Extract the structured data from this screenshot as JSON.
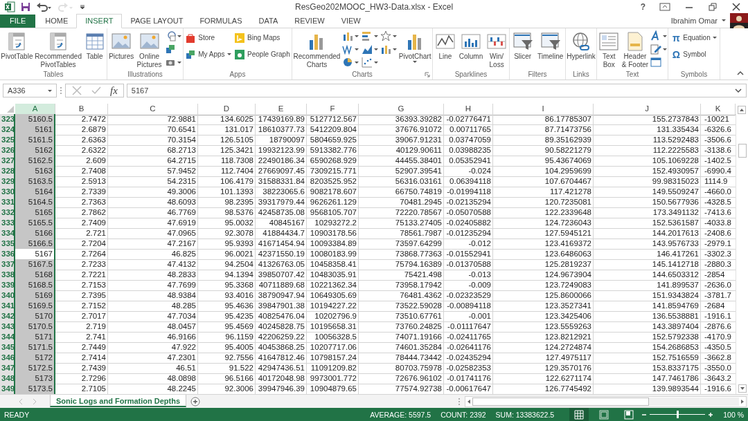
{
  "window": {
    "title": "ResGeo202MOOC_HW3-Data.xlsx - Excel",
    "help": "?"
  },
  "quick_access": [
    {
      "kind": "save",
      "disabled": false
    },
    {
      "kind": "undo",
      "disabled": false
    },
    {
      "kind": "redo",
      "disabled": true
    },
    {
      "kind": "customize",
      "disabled": false
    }
  ],
  "user": {
    "name": "Ibrahim Omar"
  },
  "tabs": [
    {
      "label": "FILE",
      "kind": "file",
      "selected": false
    },
    {
      "label": "HOME",
      "kind": "tab",
      "selected": false
    },
    {
      "label": "INSERT",
      "kind": "tab",
      "selected": true
    },
    {
      "label": "PAGE LAYOUT",
      "kind": "tab",
      "selected": false
    },
    {
      "label": "FORMULAS",
      "kind": "tab",
      "selected": false
    },
    {
      "label": "DATA",
      "kind": "tab",
      "selected": false
    },
    {
      "label": "REVIEW",
      "kind": "tab",
      "selected": false
    },
    {
      "label": "VIEW",
      "kind": "tab",
      "selected": false
    }
  ],
  "ribbon": {
    "groups": [
      {
        "label": "Tables",
        "items": [
          {
            "kind": "large",
            "label": "PivotTable",
            "dropdown": false
          },
          {
            "kind": "large",
            "label": "Recommended\nPivotTables",
            "dropdown": false
          },
          {
            "kind": "large",
            "label": "Table",
            "dropdown": false
          }
        ]
      },
      {
        "label": "Illustrations",
        "items": [
          {
            "kind": "large",
            "label": "Pictures",
            "dropdown": false
          },
          {
            "kind": "large",
            "label": "Online\nPictures",
            "dropdown": false
          },
          {
            "kind": "stack",
            "items": [
              {
                "kind": "mini",
                "dropdown": true
              },
              {
                "kind": "mini",
                "dropdown": false
              },
              {
                "kind": "mini",
                "dropdown": true
              }
            ]
          }
        ]
      },
      {
        "label": "Apps",
        "items": [
          {
            "kind": "stack",
            "items": [
              {
                "kind": "small",
                "label": "Store",
                "dropdown": false
              },
              {
                "kind": "small",
                "label": "My Apps",
                "dropdown": true
              }
            ]
          },
          {
            "kind": "stack",
            "items": [
              {
                "kind": "small",
                "label": "Bing Maps",
                "dropdown": false
              },
              {
                "kind": "small",
                "label": "People Graph",
                "dropdown": false
              }
            ]
          }
        ]
      },
      {
        "label": "Charts",
        "launcher": true,
        "items": [
          {
            "kind": "large",
            "label": "Recommended\nCharts",
            "dropdown": false
          },
          {
            "kind": "stack",
            "items": [
              {
                "kind": "mini",
                "dropdown": true
              },
              {
                "kind": "mini",
                "dropdown": true
              },
              {
                "kind": "mini",
                "dropdown": true
              }
            ]
          },
          {
            "kind": "stack",
            "items": [
              {
                "kind": "mini",
                "dropdown": true
              },
              {
                "kind": "mini",
                "dropdown": true
              },
              {
                "kind": "mini",
                "dropdown": true
              }
            ]
          },
          {
            "kind": "stack",
            "items": [
              {
                "kind": "mini",
                "dropdown": true
              },
              {
                "kind": "mini",
                "dropdown": true
              }
            ]
          },
          {
            "kind": "large",
            "label": "PivotChart",
            "dropdown": true
          }
        ]
      },
      {
        "label": "Sparklines",
        "items": [
          {
            "kind": "large",
            "label": "Line",
            "dropdown": false
          },
          {
            "kind": "large",
            "label": "Column",
            "dropdown": false
          },
          {
            "kind": "large",
            "label": "Win/\nLoss",
            "dropdown": false
          }
        ]
      },
      {
        "label": "Filters",
        "items": [
          {
            "kind": "large",
            "label": "Slicer",
            "dropdown": false
          },
          {
            "kind": "large",
            "label": "Timeline",
            "dropdown": false
          }
        ]
      },
      {
        "label": "Links",
        "items": [
          {
            "kind": "large",
            "label": "Hyperlink",
            "dropdown": false
          }
        ]
      },
      {
        "label": "Text",
        "items": [
          {
            "kind": "large",
            "label": "Text\nBox",
            "dropdown": false
          },
          {
            "kind": "large",
            "label": "Header\n& Footer",
            "dropdown": false
          },
          {
            "kind": "stack",
            "items": [
              {
                "kind": "mini",
                "dropdown": true
              },
              {
                "kind": "mini",
                "dropdown": true
              },
              {
                "kind": "mini",
                "dropdown": false
              }
            ]
          }
        ]
      },
      {
        "label": "Symbols",
        "items": [
          {
            "kind": "stack",
            "items": [
              {
                "kind": "glyph",
                "glyph": "π",
                "label": "Equation",
                "dropdown": true
              },
              {
                "kind": "glyph",
                "glyph": "Ω",
                "label": "Symbol",
                "dropdown": false
              }
            ]
          }
        ]
      }
    ]
  },
  "formula_bar": {
    "name_box": "A336",
    "fx": "fx",
    "value": "5167"
  },
  "table": {
    "columns": [
      {
        "label": "A",
        "selected": true
      },
      {
        "label": "B",
        "selected": false
      },
      {
        "label": "C",
        "selected": false
      },
      {
        "label": "D",
        "selected": false
      },
      {
        "label": "E",
        "selected": false
      },
      {
        "label": "F",
        "selected": false
      },
      {
        "label": "G",
        "selected": false
      },
      {
        "label": "H",
        "selected": false
      },
      {
        "label": "I",
        "selected": false
      },
      {
        "label": "J",
        "selected": false
      },
      {
        "label": "K",
        "selected": false
      }
    ],
    "rows": [
      {
        "header": "323",
        "selected": true,
        "active": false,
        "cells": [
          "5160.5",
          "2.7472",
          "72.9881",
          "134.6025",
          "17439169.89",
          "5127712.567",
          "36393.39282",
          "-0.02776471",
          "86.17785307",
          "155.2737843",
          "-10021"
        ]
      },
      {
        "header": "324",
        "selected": true,
        "active": false,
        "cells": [
          "5161",
          "2.6879",
          "70.6541",
          "131.017",
          "18610377.73",
          "5412209.804",
          "37676.91072",
          "0.00711765",
          "87.71473756",
          "131.335434",
          "-6326.6"
        ]
      },
      {
        "header": "325",
        "selected": true,
        "active": false,
        "cells": [
          "5161.5",
          "2.6363",
          "70.3154",
          "126.5105",
          "18790097",
          "5804659.925",
          "39067.91231",
          "0.03747059",
          "89.35162939",
          "113.5292483",
          "-3506.6"
        ]
      },
      {
        "header": "326",
        "selected": true,
        "active": false,
        "cells": [
          "5162",
          "2.6322",
          "68.2713",
          "125.3421",
          "19932123.99",
          "5913382.776",
          "40129.90611",
          "0.03988235",
          "90.58221279",
          "112.2225583",
          "-3138.6"
        ]
      },
      {
        "header": "327",
        "selected": true,
        "active": false,
        "cells": [
          "5162.5",
          "2.609",
          "64.2715",
          "118.7308",
          "22490186.34",
          "6590268.929",
          "44455.38401",
          "0.05352941",
          "95.43674069",
          "105.1069228",
          "-1402.5"
        ]
      },
      {
        "header": "328",
        "selected": true,
        "active": false,
        "cells": [
          "5163",
          "2.7408",
          "57.9452",
          "112.7404",
          "27669097.45",
          "7309215.771",
          "52907.39541",
          "-0.024",
          "104.2959699",
          "152.4930957",
          "-6990.4"
        ]
      },
      {
        "header": "329",
        "selected": true,
        "active": false,
        "cells": [
          "5163.5",
          "2.5913",
          "54.2315",
          "106.4179",
          "31588331.84",
          "8203525.952",
          "56316.03161",
          "0.06394118",
          "107.6704467",
          "99.98315023",
          "1114.9"
        ]
      },
      {
        "header": "330",
        "selected": true,
        "active": false,
        "cells": [
          "5164",
          "2.7339",
          "49.3006",
          "101.1393",
          "38223065.6",
          "9082178.607",
          "66750.74819",
          "-0.01994118",
          "117.421278",
          "149.5509247",
          "-4660.0"
        ]
      },
      {
        "header": "331",
        "selected": true,
        "active": false,
        "cells": [
          "5164.5",
          "2.7363",
          "48.6093",
          "98.2395",
          "39317979.44",
          "9626261.129",
          "70481.2945",
          "-0.02135294",
          "120.7235081",
          "150.5677936",
          "-4328.5"
        ]
      },
      {
        "header": "332",
        "selected": true,
        "active": false,
        "cells": [
          "5165",
          "2.7862",
          "46.7769",
          "98.5376",
          "42458735.08",
          "9568105.707",
          "72220.78567",
          "-0.05070588",
          "122.2339648",
          "173.3491132",
          "-7413.6"
        ]
      },
      {
        "header": "333",
        "selected": true,
        "active": false,
        "cells": [
          "5165.5",
          "2.7409",
          "47.6919",
          "95.0032",
          "40845167",
          "10293272.2",
          "75133.27405",
          "-0.02405882",
          "124.7236043",
          "152.5361587",
          "-4033.8"
        ]
      },
      {
        "header": "334",
        "selected": true,
        "active": false,
        "cells": [
          "5166",
          "2.721",
          "47.0965",
          "92.3078",
          "41884434.7",
          "10903178.56",
          "78561.7987",
          "-0.01235294",
          "127.5945121",
          "144.2017613",
          "-2408.6"
        ]
      },
      {
        "header": "335",
        "selected": true,
        "active": false,
        "cells": [
          "5166.5",
          "2.7204",
          "47.2167",
          "95.9393",
          "41671454.94",
          "10093384.89",
          "73597.64299",
          "-0.012",
          "123.4169372",
          "143.9576733",
          "-2979.1"
        ]
      },
      {
        "header": "336",
        "selected": true,
        "active": true,
        "cells": [
          "5167",
          "2.7264",
          "46.825",
          "96.0021",
          "42371550.19",
          "10080183.99",
          "73868.77363",
          "-0.01552941",
          "123.6486063",
          "146.417261",
          "-3302.3"
        ]
      },
      {
        "header": "337",
        "selected": true,
        "active": false,
        "cells": [
          "5167.5",
          "2.7233",
          "47.4132",
          "94.2504",
          "41326763.05",
          "10458358.41",
          "75794.16389",
          "-0.01370588",
          "125.2819237",
          "145.1412718",
          "-2880.3"
        ]
      },
      {
        "header": "338",
        "selected": true,
        "active": false,
        "cells": [
          "5168",
          "2.7221",
          "48.2833",
          "94.1394",
          "39850707.42",
          "10483035.91",
          "75421.498",
          "-0.013",
          "124.9673904",
          "144.6503312",
          "-2854"
        ]
      },
      {
        "header": "339",
        "selected": true,
        "active": false,
        "cells": [
          "5168.5",
          "2.7153",
          "47.7699",
          "95.3368",
          "40711889.68",
          "10221362.34",
          "73958.17942",
          "-0.009",
          "123.7249083",
          "141.899537",
          "-2636.0"
        ]
      },
      {
        "header": "340",
        "selected": true,
        "active": false,
        "cells": [
          "5169",
          "2.7395",
          "48.9384",
          "93.4016",
          "38790947.94",
          "10649305.69",
          "76481.4362",
          "-0.02323529",
          "125.8600066",
          "151.9343824",
          "-3781.7"
        ]
      },
      {
        "header": "341",
        "selected": true,
        "active": false,
        "cells": [
          "5169.5",
          "2.7152",
          "48.285",
          "95.4636",
          "39847901.38",
          "10194227.22",
          "73522.59028",
          "-0.00894118",
          "123.3527341",
          "141.8594769",
          "-2684"
        ]
      },
      {
        "header": "342",
        "selected": true,
        "active": false,
        "cells": [
          "5170",
          "2.7017",
          "47.7034",
          "95.4235",
          "40825476.04",
          "10202796.9",
          "73510.67761",
          "-0.001",
          "123.3425406",
          "136.5538881",
          "-1916.1"
        ]
      },
      {
        "header": "343",
        "selected": true,
        "active": false,
        "cells": [
          "5170.5",
          "2.719",
          "48.0457",
          "95.4569",
          "40245828.75",
          "10195658.31",
          "73760.24825",
          "-0.01117647",
          "123.5559263",
          "143.3897404",
          "-2876.6"
        ]
      },
      {
        "header": "344",
        "selected": true,
        "active": false,
        "cells": [
          "5171",
          "2.741",
          "46.9166",
          "96.1159",
          "42206259.22",
          "10056328.5",
          "74071.19166",
          "-0.02411765",
          "123.8212921",
          "152.5792338",
          "-4170.9"
        ]
      },
      {
        "header": "345",
        "selected": true,
        "active": false,
        "cells": [
          "5171.5",
          "2.7449",
          "47.922",
          "95.4005",
          "40453868.25",
          "10207717.06",
          "74601.35284",
          "-0.02641176",
          "124.2724874",
          "154.2686853",
          "-4350.5"
        ]
      },
      {
        "header": "346",
        "selected": true,
        "active": false,
        "cells": [
          "5172",
          "2.7414",
          "47.2301",
          "92.7556",
          "41647812.46",
          "10798157.24",
          "78444.73442",
          "-0.02435294",
          "127.4975117",
          "152.7516559",
          "-3662.8"
        ]
      },
      {
        "header": "347",
        "selected": true,
        "active": false,
        "cells": [
          "5172.5",
          "2.7439",
          "46.51",
          "91.522",
          "42947436.51",
          "11091209.82",
          "80703.75978",
          "-0.02582353",
          "129.3570176",
          "153.8337175",
          "-3550.0"
        ]
      },
      {
        "header": "348",
        "selected": true,
        "active": false,
        "cells": [
          "5173",
          "2.7296",
          "48.0898",
          "96.5166",
          "40172048.98",
          "9973001.772",
          "72676.96102",
          "-0.01741176",
          "122.6271174",
          "147.7461786",
          "-3643.2"
        ]
      },
      {
        "header": "349",
        "selected": true,
        "active": false,
        "cells": [
          "5173.5",
          "2.7105",
          "48.2245",
          "92.3006",
          "39947946.39",
          "10904879.65",
          "77574.92738",
          "-0.00617647",
          "126.7745492",
          "139.9893544",
          "-1916.6"
        ]
      }
    ]
  },
  "sheets": [
    {
      "label": "Sonic Logs and Formation Depths",
      "selected": true
    }
  ],
  "status_bar": {
    "mode": "READY",
    "stats": [
      "AVERAGE: 5597.5",
      "COUNT: 2392",
      "SUM: 13383622.5"
    ],
    "views": [
      {
        "kind": "normal",
        "selected": true
      },
      {
        "kind": "layout",
        "selected": false
      },
      {
        "kind": "break",
        "selected": false
      }
    ],
    "zoom": {
      "level": 0.5,
      "label": "100 %"
    }
  }
}
